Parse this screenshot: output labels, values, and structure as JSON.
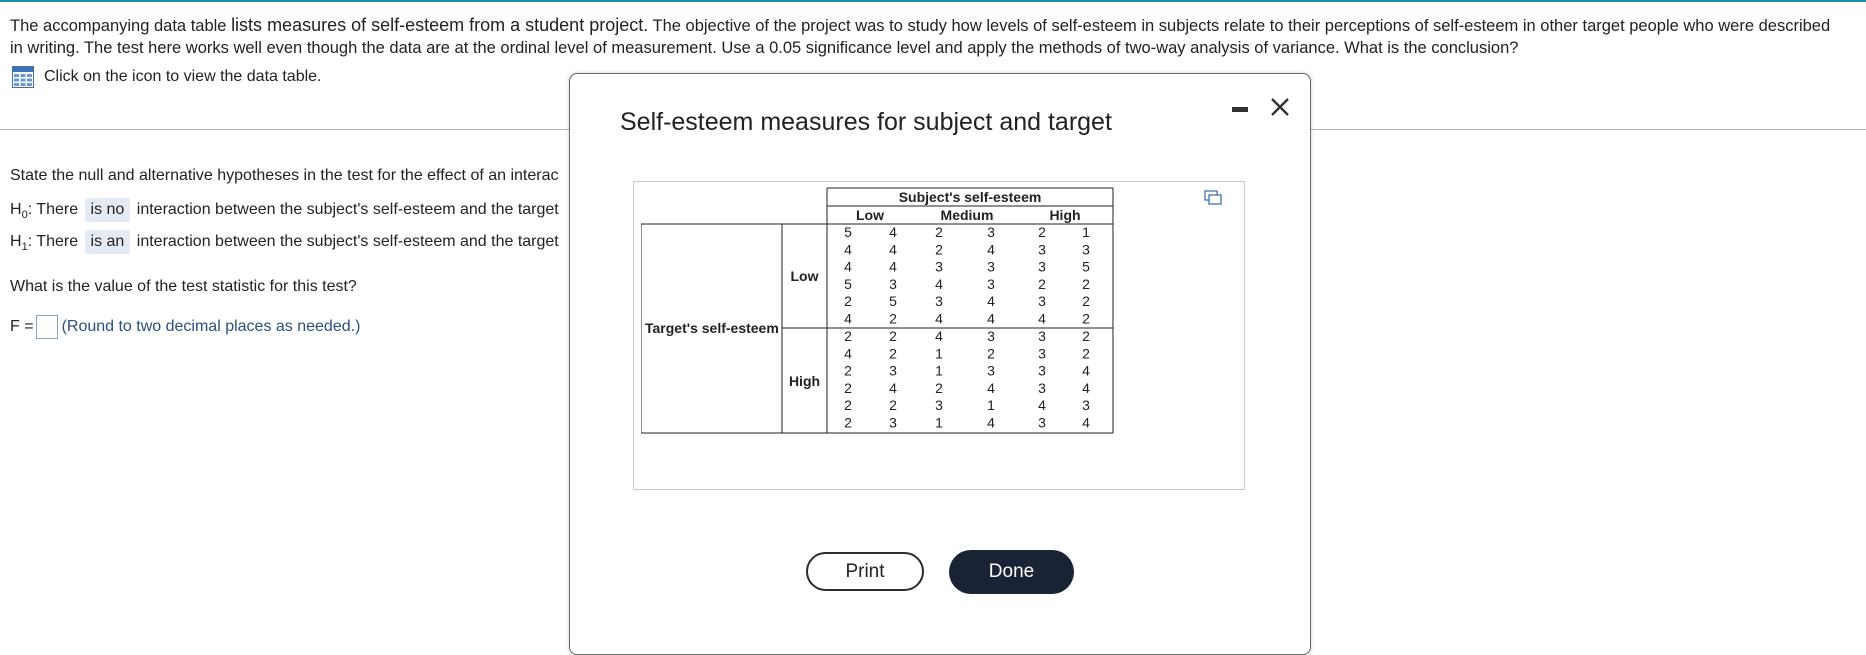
{
  "question": {
    "part1": "The accompanying data table ",
    "part2": "lists measures of self-esteem from a student project.",
    "part3": " The objective of the project was to study how levels of self-esteem in subjects relate to their perceptions of self-esteem in other target people who were described in writing. The test here works well even though the data are at the ordinal level of measurement. Use a 0.05 significance level and apply the methods of two-way analysis of variance. What is the conclusion?"
  },
  "icon_link": {
    "label": "Click on the icon to view the data table."
  },
  "prompt1": "State the null and alternative hypotheses in the test for the effect of an interac",
  "h0": {
    "symbol": "H",
    "sub": "0",
    "lead": ": There ",
    "choice": "is no",
    "rest": " interaction between the subject's self-esteem and the target"
  },
  "h1": {
    "symbol": "H",
    "sub": "1",
    "lead": ": There ",
    "choice": "is an",
    "rest": " interaction between the subject's self-esteem and the target"
  },
  "prompt2": "What is the value of the test statistic for this test?",
  "answer": {
    "label": "F =",
    "value": "",
    "hint": "(Round to two decimal places as needed.)"
  },
  "modal": {
    "title": "Self-esteem measures for subject and target",
    "print_label": "Print",
    "done_label": "Done"
  },
  "table": {
    "header": "Subject's self-esteem",
    "subject_levels": [
      "Low",
      "Medium",
      "High"
    ],
    "row_header": "Target's self-esteem",
    "target_levels": [
      "Low",
      "High"
    ],
    "low_rows": [
      [
        "5",
        "4",
        "2",
        "3",
        "2",
        "1"
      ],
      [
        "4",
        "4",
        "2",
        "4",
        "3",
        "3"
      ],
      [
        "4",
        "4",
        "3",
        "3",
        "3",
        "5"
      ],
      [
        "5",
        "3",
        "4",
        "3",
        "2",
        "2"
      ],
      [
        "2",
        "5",
        "3",
        "4",
        "3",
        "2"
      ],
      [
        "4",
        "2",
        "4",
        "4",
        "4",
        "2"
      ]
    ],
    "high_rows": [
      [
        "2",
        "2",
        "4",
        "3",
        "3",
        "2"
      ],
      [
        "4",
        "2",
        "1",
        "2",
        "3",
        "2"
      ],
      [
        "2",
        "3",
        "1",
        "3",
        "3",
        "4"
      ],
      [
        "2",
        "4",
        "2",
        "4",
        "3",
        "4"
      ],
      [
        "2",
        "2",
        "3",
        "1",
        "4",
        "3"
      ],
      [
        "2",
        "3",
        "1",
        "4",
        "3",
        "4"
      ]
    ]
  },
  "colors": {
    "accent_line": "#1a8fa8",
    "done_button": "#192335",
    "selection_bg": "#e4ebf4"
  },
  "icons": [
    "table-icon",
    "minimize-icon",
    "close-icon",
    "copy-icon"
  ]
}
